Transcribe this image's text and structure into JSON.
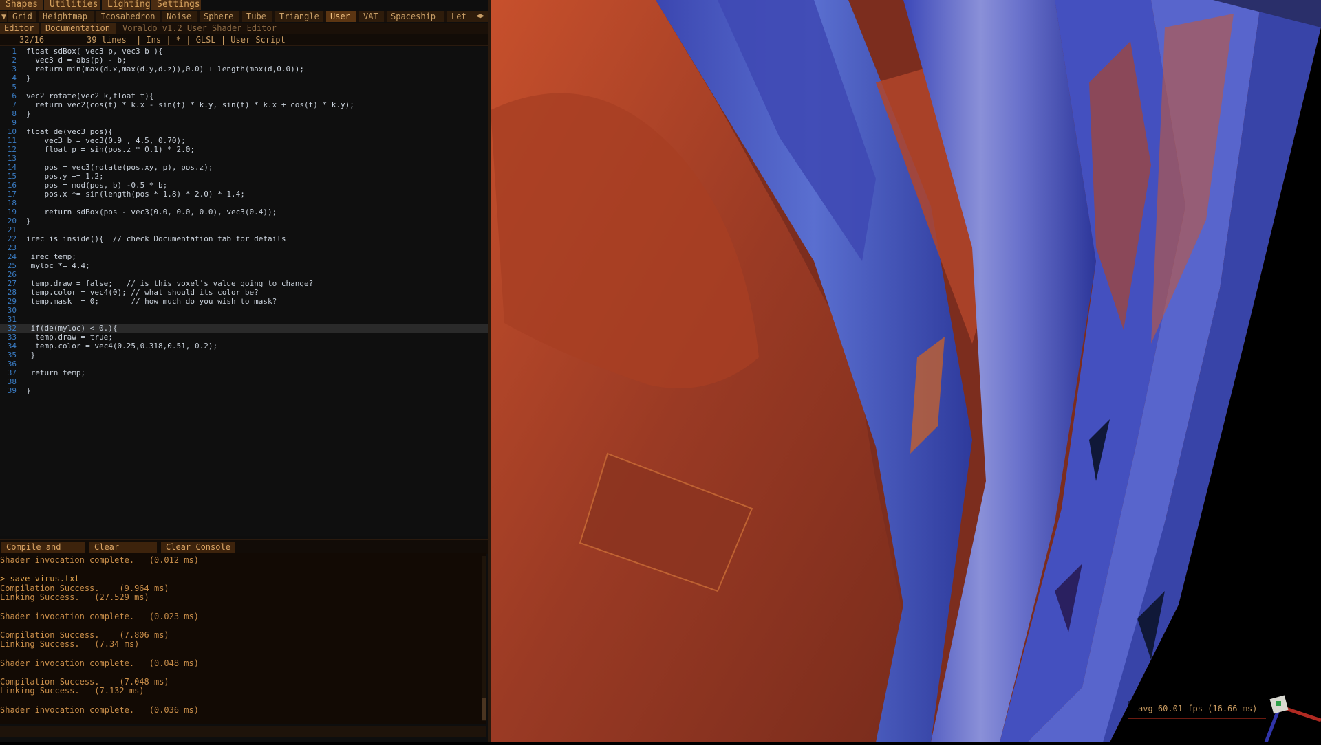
{
  "menu": [
    "Shapes",
    "Utilities",
    "Lighting",
    "Settings"
  ],
  "shape_tabs": {
    "arrow_left": "▼",
    "items": [
      "Grid",
      "Heightmap",
      "Icosahedron",
      "Noise",
      "Sphere",
      "Tube",
      "Triangle",
      "User",
      "VAT",
      "Spaceship",
      "Let"
    ],
    "active": "User",
    "scroll_arrows": "◀▶"
  },
  "editor_tabs": {
    "items": [
      "Editor",
      "Documentation"
    ],
    "title": "Voraldo v1.2 User Shader Editor"
  },
  "status": {
    "cursor": "32/16",
    "lines": "39 lines",
    "mode": "| Ins | * | GLSL | User Script"
  },
  "code": [
    "float sdBox( vec3 p, vec3 b ){",
    "  vec3 d = abs(p) - b;",
    "  return min(max(d.x,max(d.y,d.z)),0.0) + length(max(d,0.0));",
    "}",
    "",
    "vec2 rotate(vec2 k,float t){",
    "  return vec2(cos(t) * k.x - sin(t) * k.y, sin(t) * k.x + cos(t) * k.y);",
    "}",
    "",
    "float de(vec3 pos){",
    "    vec3 b = vec3(0.9 , 4.5, 0.70);",
    "    float p = sin(pos.z * 0.1) * 2.0;",
    "",
    "    pos = vec3(rotate(pos.xy, p), pos.z);",
    "    pos.y += 1.2;",
    "    pos = mod(pos, b) -0.5 * b;",
    "    pos.x *= sin(length(pos * 1.8) * 2.0) * 1.4;",
    "",
    "    return sdBox(pos - vec3(0.0, 0.0, 0.0), vec3(0.4));",
    "}",
    "",
    "irec is_inside(){  // check Documentation tab for details",
    "",
    " irec temp;",
    " myloc *= 4.4;",
    "",
    " temp.draw = false;   // is this voxel's value going to change?",
    " temp.color = vec4(0); // what should its color be?",
    " temp.mask  = 0;       // how much do you wish to mask?",
    "",
    "",
    " if(de(myloc) < 0.){",
    "  temp.draw = true;",
    "  temp.color = vec4(0.25,0.318,0.51, 0.2);",
    " }",
    "",
    " return temp;",
    "",
    "}"
  ],
  "current_line": 32,
  "buttons": [
    "Compile and Run",
    "Clear Editor",
    "Clear Console"
  ],
  "console": [
    "Shader invocation complete.   (0.012 ms)",
    "",
    "> save virus.txt",
    "Compilation Success.    (9.964 ms)",
    "Linking Success.   (27.529 ms)",
    "",
    "Shader invocation complete.   (0.023 ms)",
    "",
    "Compilation Success.    (7.806 ms)",
    "Linking Success.   (7.34 ms)",
    "",
    "Shader invocation complete.   (0.048 ms)",
    "",
    "Compilation Success.    (7.048 ms)",
    "Linking Success.   (7.132 ms)",
    "",
    "Shader invocation complete.   (0.036 ms)"
  ],
  "fps": "avg 60.01 fps (16.66 ms)",
  "colors": {
    "accent": "#4a2c12",
    "text_orange": "#d7a25e",
    "line_number": "#3a7cc4",
    "keyword": "#5aa0e6",
    "number": "#43c443",
    "comment": "#2f7a6a"
  }
}
